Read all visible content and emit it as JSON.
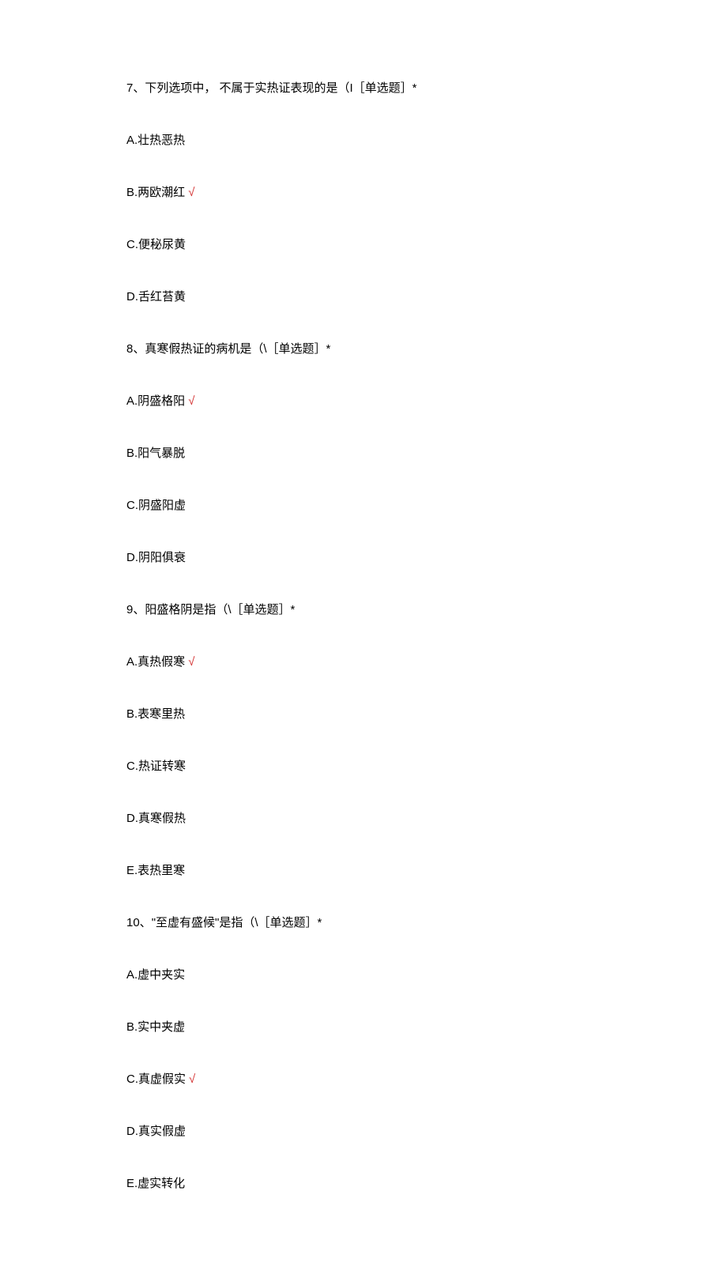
{
  "questions": [
    {
      "number": "7、",
      "text": "下列选项中， 不属于实热证表现的是（I［单选题］*",
      "options": [
        {
          "label": "A.壮热恶热",
          "correct": false
        },
        {
          "label": "B.两欧潮红",
          "correct": true
        },
        {
          "label": "C.便秘尿黄",
          "correct": false
        },
        {
          "label": "D.舌红苔黄",
          "correct": false
        }
      ]
    },
    {
      "number": "8、",
      "text": "真寒假热证的病机是（\\［单选题］*",
      "options": [
        {
          "label": "A.阴盛格阳",
          "correct": true
        },
        {
          "label": "B.阳气暴脱",
          "correct": false
        },
        {
          "label": "C.阴盛阳虚",
          "correct": false
        },
        {
          "label": "D.阴阳俱衰",
          "correct": false
        }
      ]
    },
    {
      "number": "9、",
      "text": "阳盛格阴是指（\\［单选题］*",
      "options": [
        {
          "label": "A.真热假寒",
          "correct": true
        },
        {
          "label": "B.表寒里热",
          "correct": false
        },
        {
          "label": "C.热证转寒",
          "correct": false
        },
        {
          "label": "D.真寒假热",
          "correct": false
        },
        {
          "label": "E.表热里寒",
          "correct": false
        }
      ]
    },
    {
      "number": "10、",
      "text": "\"至虚有盛候\"是指（\\［单选题］*",
      "options": [
        {
          "label": "A.虚中夹实",
          "correct": false
        },
        {
          "label": "B.实中夹虚",
          "correct": false
        },
        {
          "label": "C.真虚假实",
          "correct": true
        },
        {
          "label": "D.真实假虚",
          "correct": false
        },
        {
          "label": "E.虚实转化",
          "correct": false
        }
      ]
    }
  ],
  "checkmark": "√"
}
